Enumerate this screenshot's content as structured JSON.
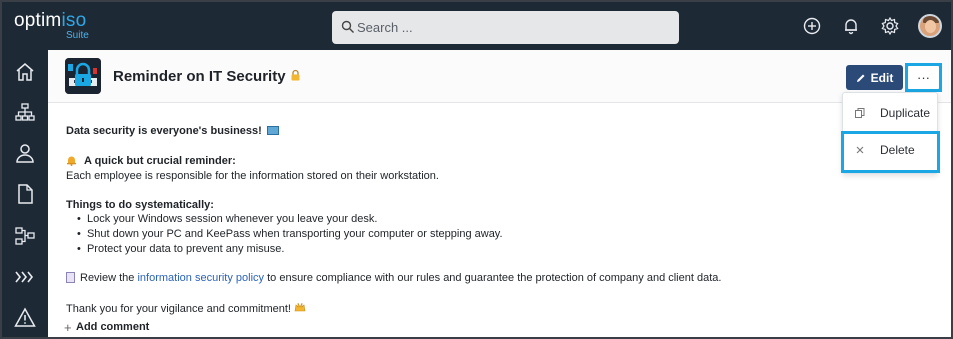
{
  "app": {
    "logo_text_pre": "optim",
    "logo_text_accent": "iso",
    "logo_sub": "Suite"
  },
  "topbar": {
    "search_placeholder": "Search ...",
    "icons": [
      "add-icon",
      "bell-icon",
      "gear-icon",
      "avatar"
    ]
  },
  "sidebar": {
    "items": [
      "home-icon",
      "org-chart-icon",
      "user-icon",
      "document-icon",
      "process-map-icon",
      "chevrons-icon",
      "warning-icon"
    ]
  },
  "page": {
    "title": "Reminder on IT Security",
    "edit_label": "Edit",
    "more_label": "···"
  },
  "menu": {
    "items": [
      {
        "label": "Duplicate",
        "icon": "duplicate-icon"
      },
      {
        "label": "Delete",
        "icon": "close-icon"
      }
    ]
  },
  "content": {
    "heading": "Data security is everyone's business!",
    "reminder_title": "A quick but crucial reminder:",
    "reminder_text": "Each employee is responsible for the information stored on their workstation.",
    "todo_title": "Things to do systematically:",
    "bullets": [
      "Lock your Windows session whenever you leave your desk.",
      "Shut down your PC and KeePass when transporting your computer or stepping away.",
      "Protect your data to prevent any misuse."
    ],
    "review_pre": "Review the ",
    "review_link": "information security policy",
    "review_post": " to ensure compliance with our rules and guarantee the protection of company and client data.",
    "thanks": "Thank you for your vigilance and commitment!",
    "add_comment": "Add comment"
  },
  "colors": {
    "topbar": "#1e2936",
    "accent": "#1aa7e3",
    "edit_button": "#2b4a78",
    "link": "#2b63b8"
  }
}
